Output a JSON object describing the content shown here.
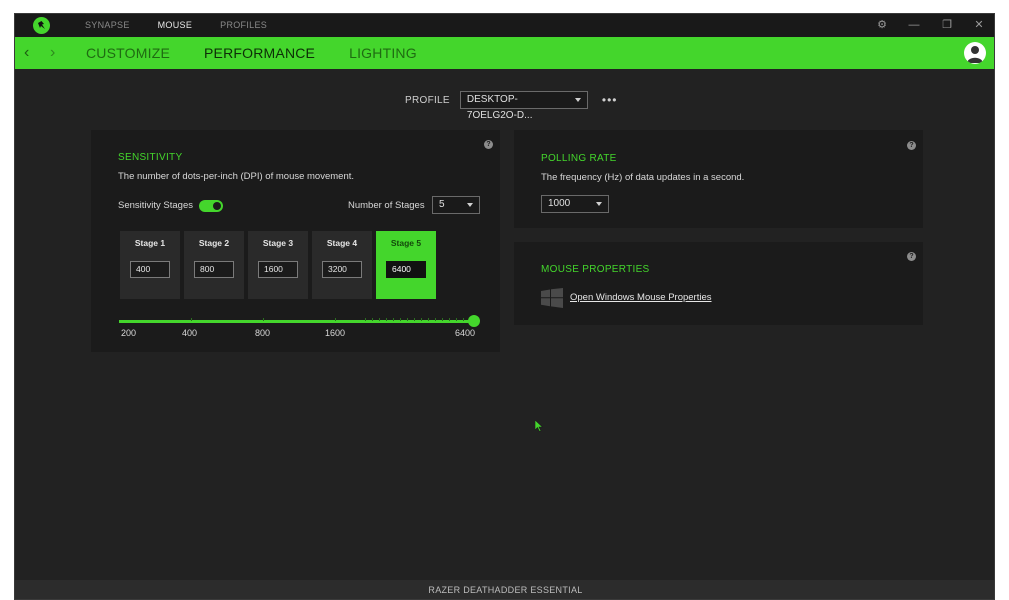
{
  "topnav": {
    "items": [
      "SYNAPSE",
      "MOUSE",
      "PROFILES"
    ],
    "active": "MOUSE"
  },
  "subtabs": {
    "items": [
      "CUSTOMIZE",
      "PERFORMANCE",
      "LIGHTING"
    ],
    "active": "PERFORMANCE"
  },
  "profile": {
    "label": "PROFILE",
    "value": "DESKTOP-7OELG2O-D...",
    "more": "•••"
  },
  "sensitivity": {
    "title": "SENSITIVITY",
    "desc": "The number of dots-per-inch (DPI) of mouse movement.",
    "stages_label": "Sensitivity Stages",
    "stages_enabled": true,
    "num_stages_label": "Number of Stages",
    "num_stages_value": "5",
    "stages": [
      {
        "label": "Stage 1",
        "value": "400"
      },
      {
        "label": "Stage 2",
        "value": "800"
      },
      {
        "label": "Stage 3",
        "value": "1600"
      },
      {
        "label": "Stage 4",
        "value": "3200"
      },
      {
        "label": "Stage 5",
        "value": "6400"
      }
    ],
    "active_stage": 5,
    "slider_labels": [
      "200",
      "400",
      "800",
      "1600",
      "6400"
    ],
    "slider_value": "6400"
  },
  "polling": {
    "title": "POLLING RATE",
    "desc": "The frequency (Hz) of data updates in a second.",
    "value": "1000"
  },
  "mouse_props": {
    "title": "MOUSE PROPERTIES",
    "link": "Open Windows Mouse Properties"
  },
  "footer": {
    "device": "RAZER DEATHADDER ESSENTIAL"
  },
  "colors": {
    "accent": "#44d62c",
    "panel": "#1b1b1b",
    "background": "#222222"
  }
}
